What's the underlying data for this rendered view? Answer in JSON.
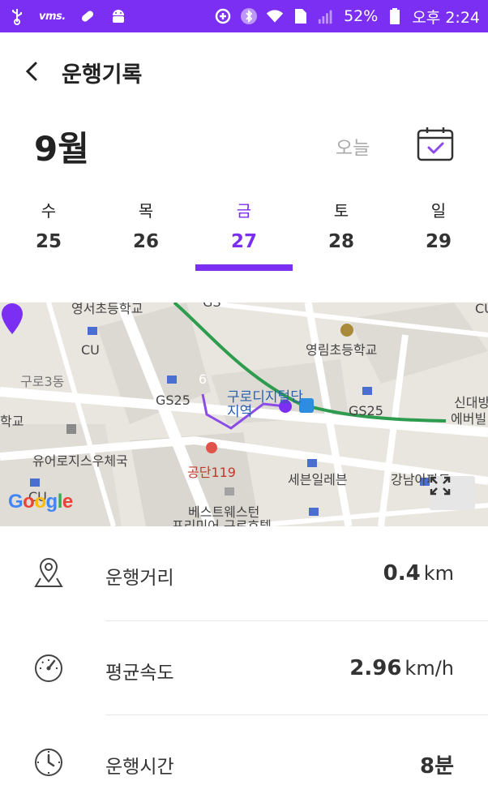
{
  "status_bar": {
    "battery": "52%",
    "time": "오후 2:24",
    "vms_label": "vms."
  },
  "header": {
    "title": "운행기록"
  },
  "month": {
    "label": "9월",
    "today_button": "오늘"
  },
  "week": [
    {
      "name": "수",
      "date": "25"
    },
    {
      "name": "목",
      "date": "26"
    },
    {
      "name": "금",
      "date": "27"
    },
    {
      "name": "토",
      "date": "28"
    },
    {
      "name": "일",
      "date": "29"
    }
  ],
  "map": {
    "labels": {
      "school1": "영서초등학교",
      "cu": "CU",
      "guro3": "구로3동",
      "gs25a": "GS25",
      "station": "구로디지털단지역",
      "school2": "영림초등학교",
      "gs25b": "GS25",
      "sindae": "신대방",
      "ever": "에버빌",
      "school3": "학교",
      "post": "유어로지스우체국",
      "gongdan": "공단119",
      "seven": "세븐일레븐",
      "gangnam": "강남아파트",
      "cu2": "CU",
      "best": "베스트웨스턴",
      "premier": "프리미어 구로호텔",
      "edge": "CU",
      "gs": "GS"
    },
    "pin_number": "6",
    "logo": "Google"
  },
  "stats": {
    "distance": {
      "label": "운행거리",
      "value": "0.4",
      "unit": "km"
    },
    "speed": {
      "label": "평균속도",
      "value": "2.96",
      "unit": "km/h"
    },
    "time": {
      "label": "운행시간",
      "value": "8분",
      "unit": ""
    }
  }
}
